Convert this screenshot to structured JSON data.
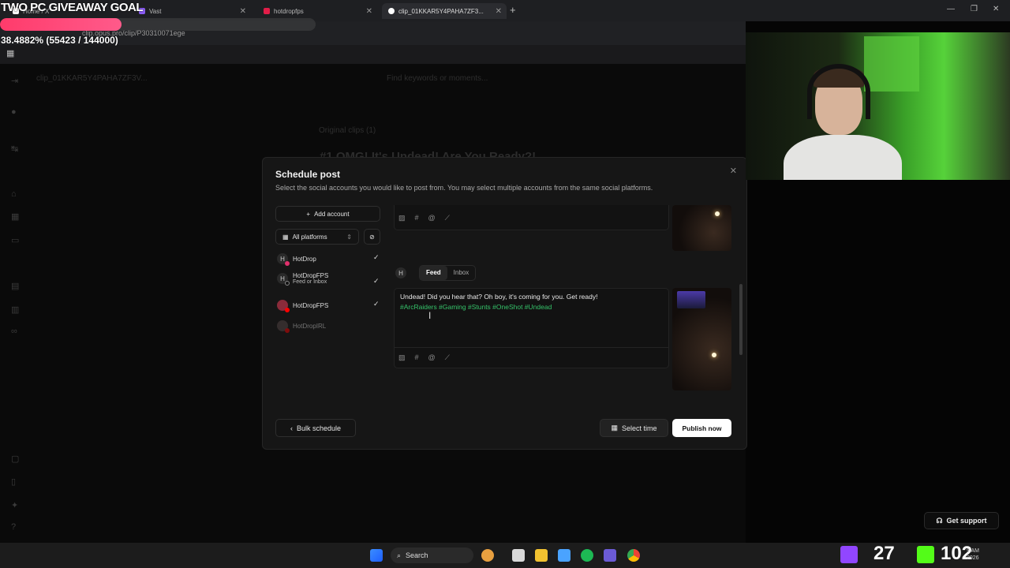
{
  "overlay": {
    "giveaway": "TWO PC GIVEAWAY GOAL",
    "progress_text": "38.4882% (55423 / 144000)",
    "progress_fraction": 0.384882
  },
  "browser": {
    "tabs": [
      {
        "label": "Home / X",
        "favicon_color": "#ffffff"
      },
      {
        "label": "Vast",
        "favicon_color": "#8b5cf6"
      },
      {
        "label": "hotdropfps",
        "favicon_color": "#e11d48"
      },
      {
        "label": "clip_01KKAR5Y4PAHA7ZF3...",
        "favicon_color": "#ffffff"
      }
    ],
    "url": "clip.opus.pro/clip/P30310071ege",
    "new_tab": "+"
  },
  "app_bg": {
    "clip_name": "clip_01KKAR5Y4PAHA7ZF3V...",
    "search_placeholder": "Find keywords or moments...",
    "original_clips": "Original clips  (1)",
    "headline": "#1 OMG! It's Undead! Are You Ready?!"
  },
  "modal": {
    "title": "Schedule post",
    "subtitle": "Select the social accounts you would like to post from. You may select multiple accounts from the same social platforms.",
    "add_account": "Add account",
    "platform_filter": "All platforms",
    "accounts": [
      {
        "name": "HotDrop",
        "initial": "H",
        "sub": "",
        "checked": true,
        "badge_color": "#e1306c"
      },
      {
        "name": "HotDropFPS",
        "initial": "H",
        "sub": "Feed or Inbox",
        "checked": true,
        "badge_color": "#111111"
      },
      {
        "name": "HotDropFPS",
        "initial": "",
        "sub": "",
        "checked": true,
        "badge_color": "#ff0000"
      },
      {
        "name": "HotDropIRL",
        "initial": "",
        "sub": "",
        "checked": false,
        "badge_color": "#ff0000"
      }
    ],
    "composer": {
      "avatar_initial": "H",
      "tabs": [
        "Feed",
        "Inbox"
      ],
      "active_tab": "Feed",
      "text": "Undead! Did you hear that? Oh boy, it's coming for you. Get ready!",
      "hashtags": "#ArcRaiders #Gaming #Stunts #OneShot #Undead"
    },
    "bulk_schedule": "Bulk schedule",
    "select_time": "Select time",
    "publish_now": "Publish now"
  },
  "support": {
    "label": "Get support"
  },
  "taskbar": {
    "search": "Search",
    "stat1": "27",
    "stat2": "102",
    "time": "9 AM",
    "date": "2026"
  }
}
